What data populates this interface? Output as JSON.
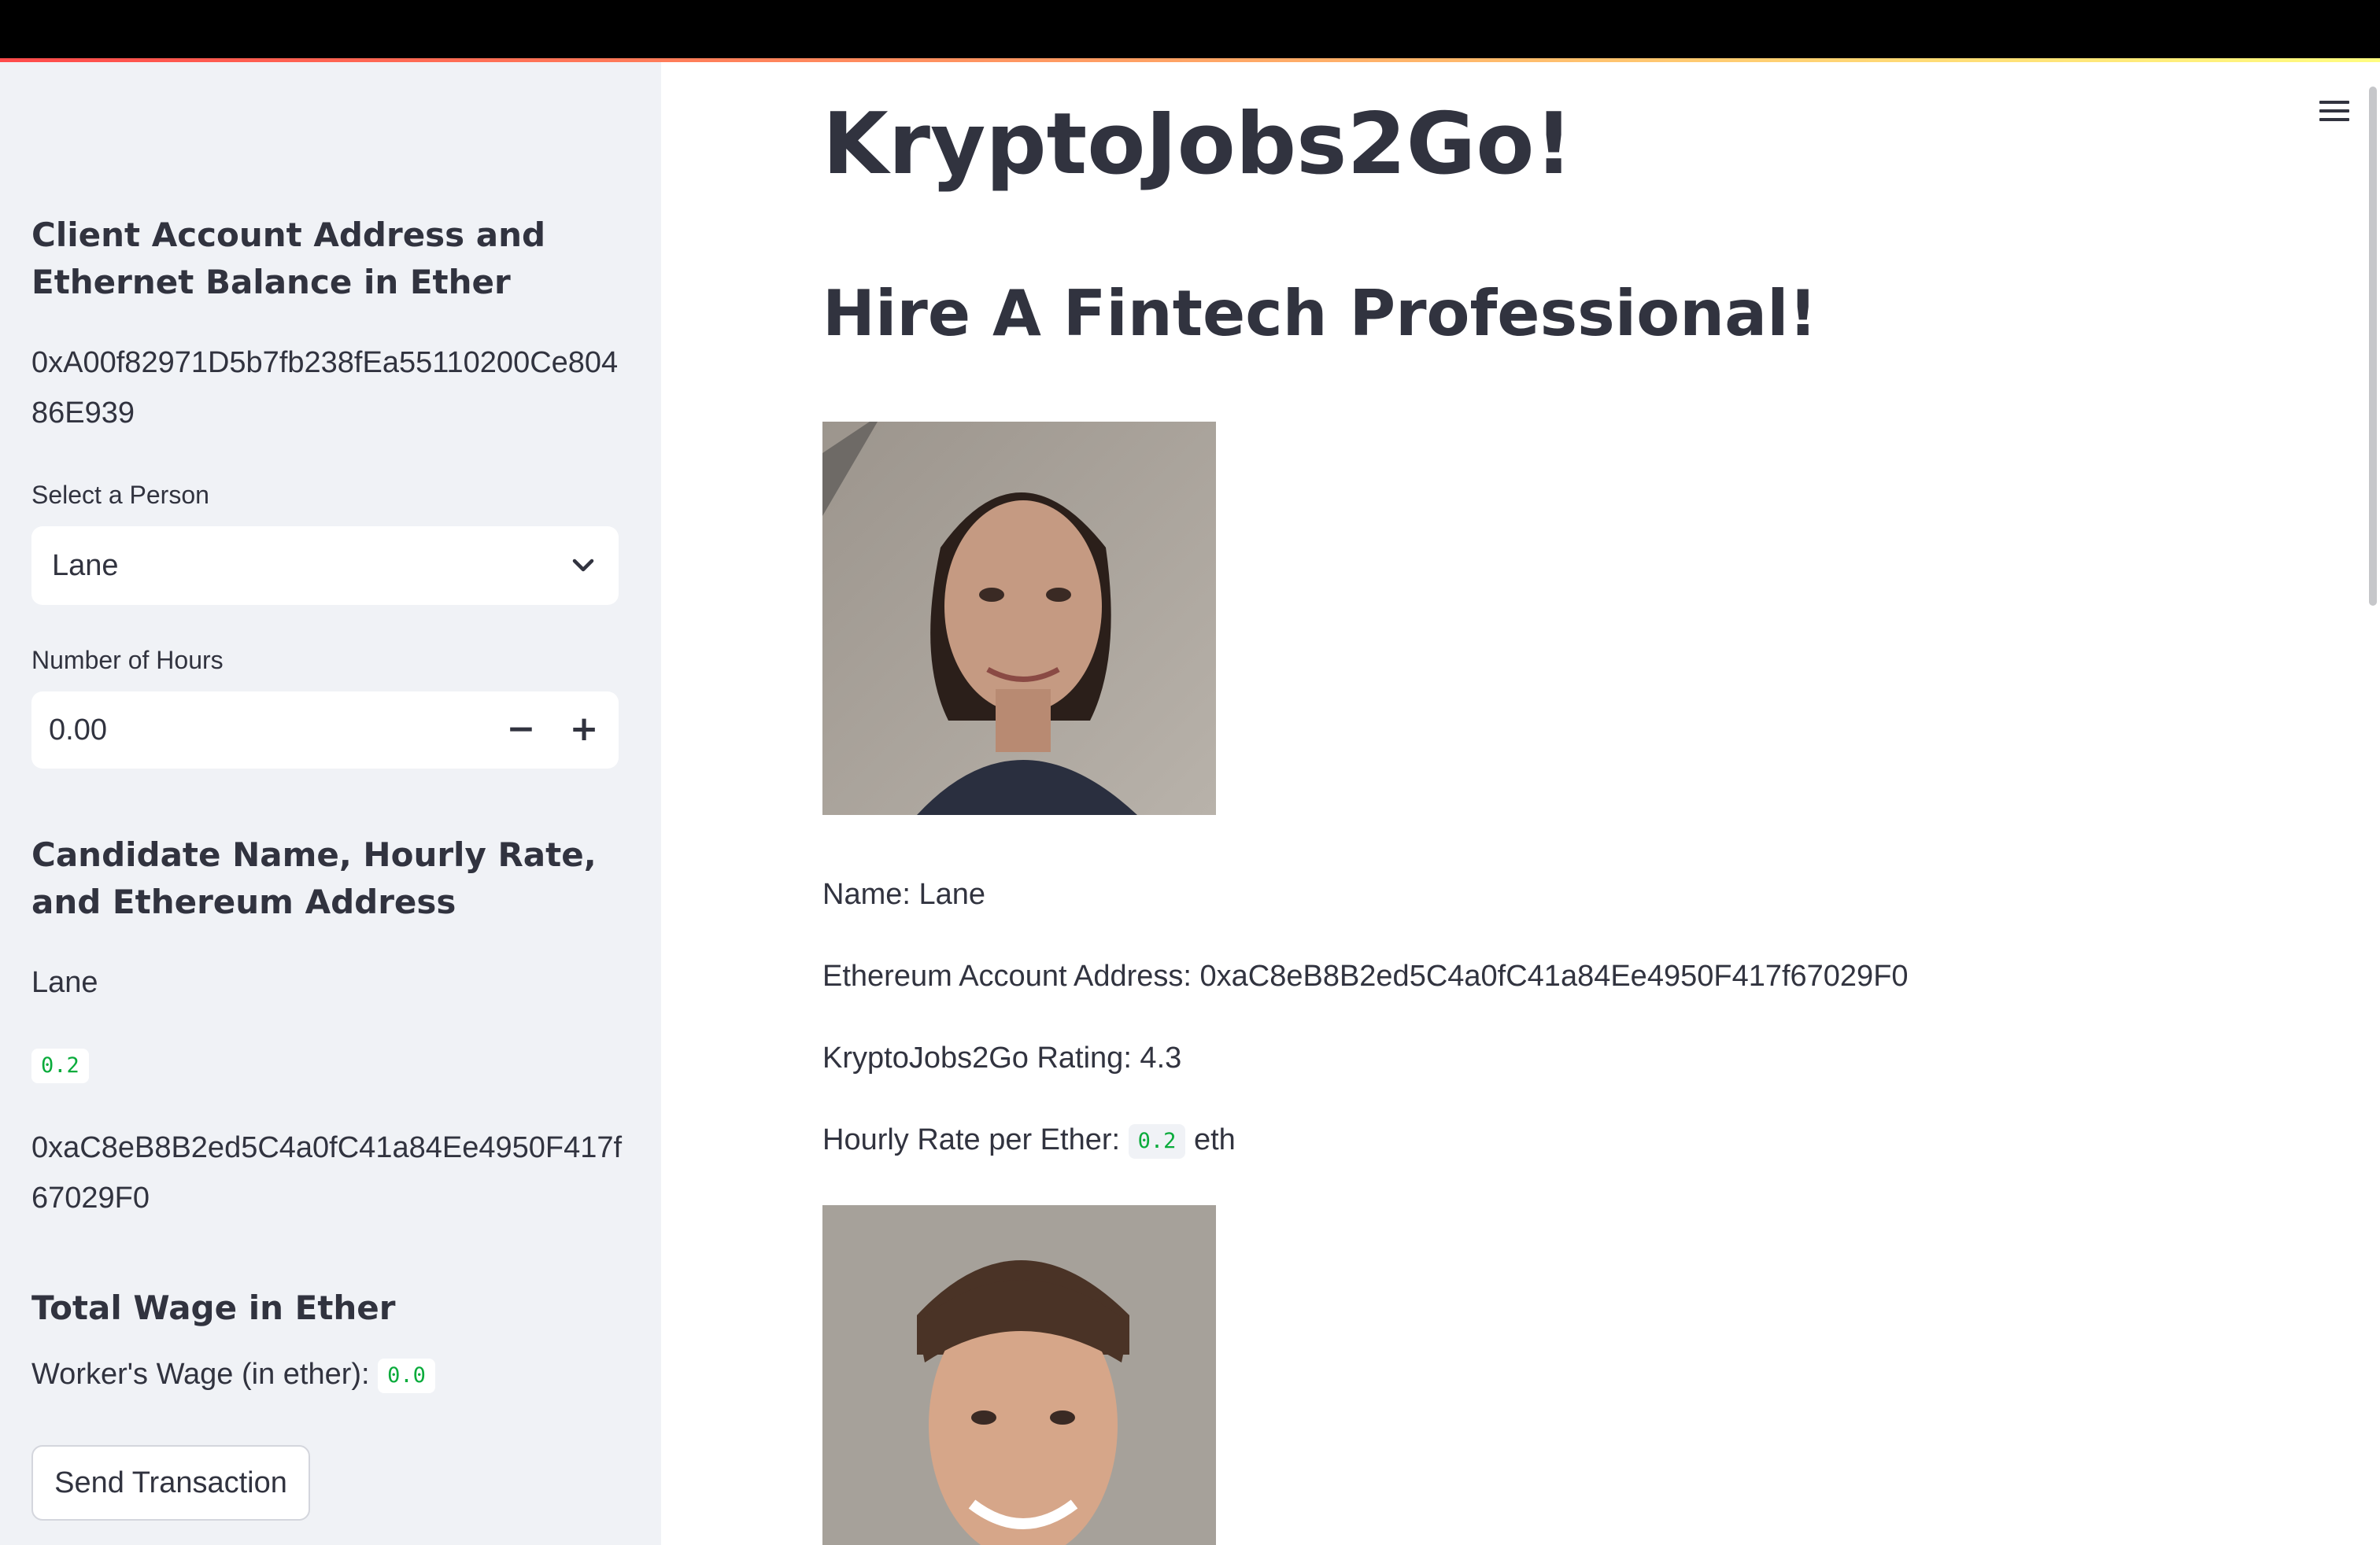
{
  "sidebar": {
    "account_heading": "Client Account Address and Ethernet Balance in Ether",
    "account_address": "0xA00f82971D5b7fb238fEa55110200Ce80486E939",
    "select_label": "Select a Person",
    "select_value": "Lane",
    "hours_label": "Number of Hours",
    "hours_value": "0.00",
    "stepper_minus": "−",
    "stepper_plus": "+",
    "candidate_heading": "Candidate Name, Hourly Rate, and Ethereum Address",
    "candidate_name": "Lane",
    "candidate_rate": "0.2",
    "candidate_address": "0xaC8eB8B2ed5C4a0fC41a84Ee4950F417f67029F0",
    "wage_heading": "Total Wage in Ether",
    "wage_label": "Worker's Wage (in ether):",
    "wage_value": "0.0",
    "send_button": "Send Transaction"
  },
  "main": {
    "title": "KryptoJobs2Go!",
    "subtitle": "Hire A Fintech Professional!",
    "candidate": {
      "name_line": "Name: Lane",
      "address_line": "Ethereum Account Address: 0xaC8eB8B2ed5C4a0fC41a84Ee4950F417f67029F0",
      "rating_line": "KryptoJobs2Go Rating: 4.3",
      "rate_prefix": "Hourly Rate per Ether:",
      "rate_value": "0.2",
      "rate_suffix": "eth"
    }
  },
  "colors": {
    "sidebar_bg": "#f0f2f6",
    "text": "#31333f",
    "code_green": "#09ab3b",
    "header_bar": "#000000"
  },
  "icons": {
    "select": "chevron-down-icon",
    "menu": "hamburger-menu-icon"
  }
}
